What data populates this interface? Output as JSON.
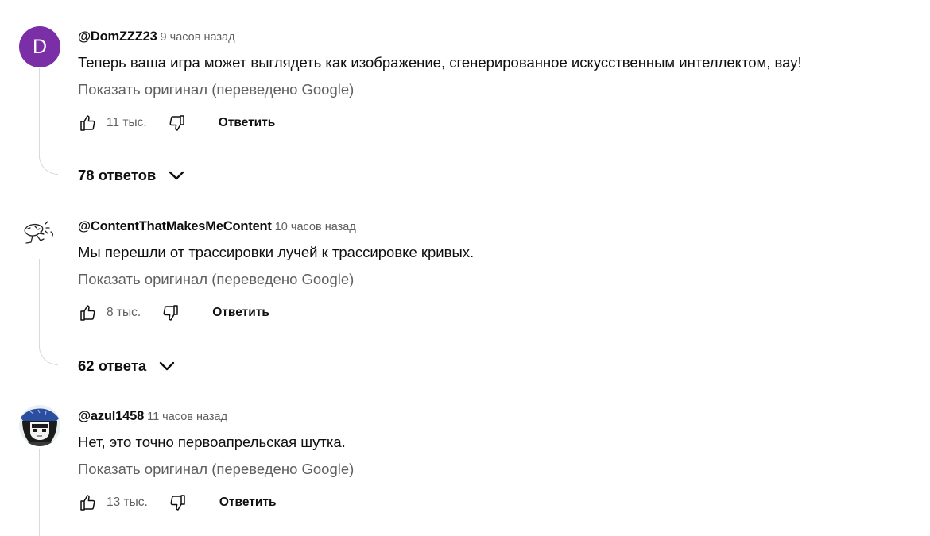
{
  "comments": [
    {
      "avatar": {
        "type": "letter",
        "letter": "D",
        "color": "#7b2fa6"
      },
      "author": "@DomZZZ23",
      "time": "9 часов назад",
      "text": "Теперь ваша игра может выглядеть как изображение, сгенерированное искусственным интеллектом, вау!",
      "translate_link": "Показать оригинал (переведено Google)",
      "likes": "11 тыс.",
      "reply_label": "Ответить",
      "replies_label": "78 ответов"
    },
    {
      "avatar": {
        "type": "image",
        "icon": "sketch-character-avatar"
      },
      "author": "@ContentThatMakesMeContent",
      "time": "10 часов назад",
      "text": "Мы перешли от трассировки лучей к трассировке кривых.",
      "translate_link": "Показать оригинал (переведено Google)",
      "likes": "8 тыс.",
      "reply_label": "Ответить",
      "replies_label": "62 ответа"
    },
    {
      "avatar": {
        "type": "image",
        "icon": "anime-character-avatar"
      },
      "author": "@azul1458",
      "time": "11 часов назад",
      "text": "Нет, это точно первоапрельская шутка.",
      "translate_link": "Показать оригинал (переведено Google)",
      "likes": "13 тыс.",
      "reply_label": "Ответить"
    }
  ],
  "icons": {
    "like": "thumbs-up-icon",
    "dislike": "thumbs-down-icon",
    "expand": "chevron-down-icon"
  },
  "colors": {
    "text": "#0f0f0f",
    "secondary": "#606060",
    "thread_line": "#d9d9d9"
  }
}
